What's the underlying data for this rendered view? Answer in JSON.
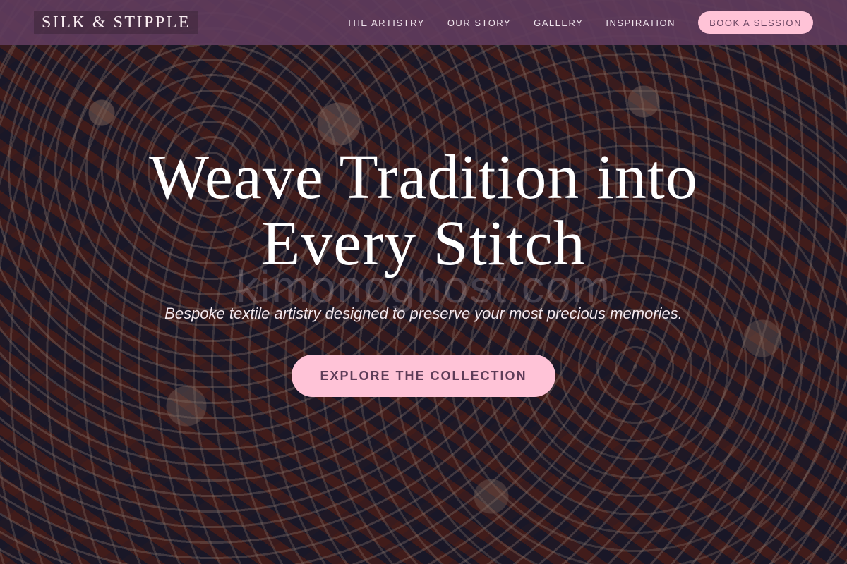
{
  "navbar": {
    "logo": "SILK & STIPPLE",
    "links": [
      "THE ARTISTRY",
      "OUR STORY",
      "GALLERY",
      "INSPIRATION"
    ],
    "cta": "BOOK A SESSION"
  },
  "hero": {
    "title_line1": "Weave Tradition into",
    "title_line2": "Every Stitch",
    "subtitle": "Bespoke textile artistry designed to preserve your most precious memories.",
    "cta": "EXPLORE THE COLLECTION",
    "watermark": "kimonoghost.com"
  },
  "colors": {
    "navbar_bg": "#603c5c",
    "accent_pink": "#ffc3d7",
    "button_text": "#5e3c58",
    "title_text": "#ffffff"
  }
}
